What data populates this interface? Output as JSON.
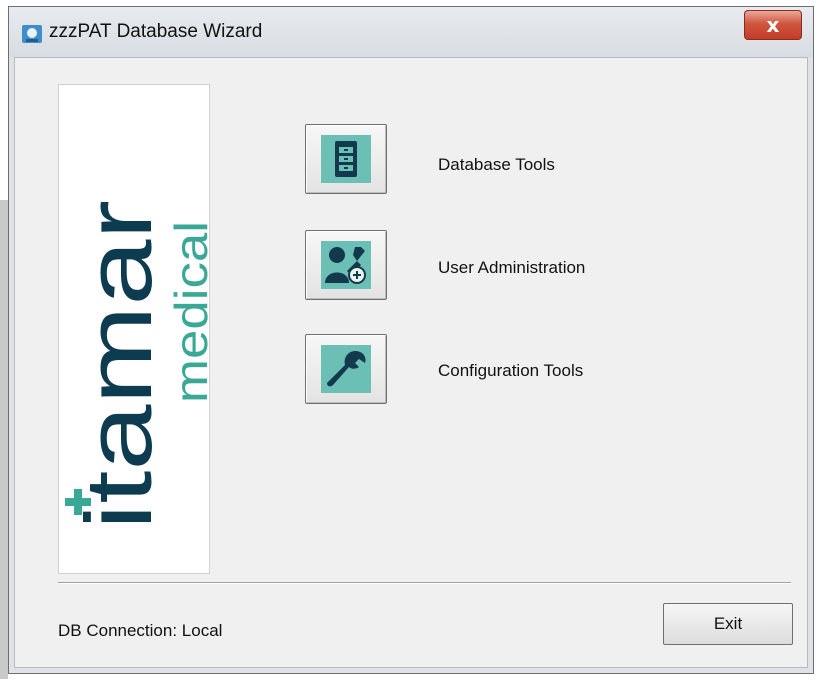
{
  "window": {
    "title": "zzzPAT Database Wizard",
    "close_label": "x"
  },
  "logo": {
    "brand": "itamar",
    "sub": "medical",
    "brand_color": "#0d3b4f",
    "accent_color": "#3aa897"
  },
  "tools": [
    {
      "label": "Database Tools",
      "icon": "database-icon"
    },
    {
      "label": "User Administration",
      "icon": "user-admin-icon"
    },
    {
      "label": "Configuration Tools",
      "icon": "wrench-icon"
    }
  ],
  "status": {
    "connection_text": "DB Connection: Local"
  },
  "buttons": {
    "exit_label": "Exit"
  }
}
